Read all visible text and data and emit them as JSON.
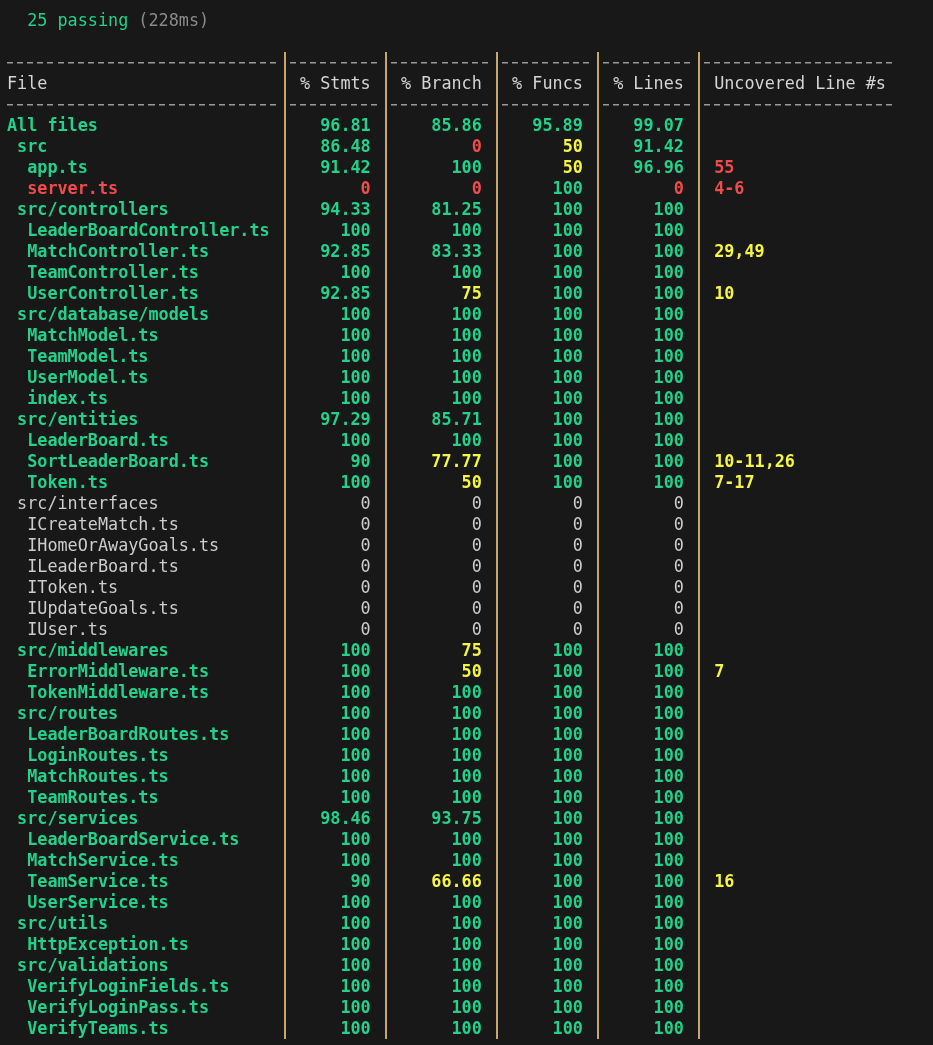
{
  "summary": {
    "count_text": "25 passing",
    "duration": "(228ms)"
  },
  "columns": [
    "File",
    "% Stmts",
    "% Branch",
    "% Funcs",
    "% Lines",
    "Uncovered Line #s"
  ],
  "rows": [
    {
      "name": "All files",
      "bold": true,
      "color": "#23d18b",
      "cells": [
        {
          "text": "96.81",
          "color": "#23d18b"
        },
        {
          "text": "85.86",
          "color": "#23d18b"
        },
        {
          "text": "95.89",
          "color": "#23d18b"
        },
        {
          "text": "99.07",
          "color": "#23d18b"
        }
      ],
      "children": [
        {
          "name": "src",
          "bold": true,
          "color": "#23d18b",
          "cells": [
            {
              "text": "86.48",
              "color": "#23d18b"
            },
            {
              "text": "0",
              "color": "#f14c4c"
            },
            {
              "text": "50",
              "color": "#f5f543"
            },
            {
              "text": "91.42",
              "color": "#23d18b"
            }
          ],
          "children": [
            {
              "name": "app.ts",
              "bold": true,
              "color": "#23d18b",
              "cells": [
                {
                  "text": "91.42",
                  "color": "#23d18b"
                },
                {
                  "text": "100",
                  "color": "#23d18b"
                },
                {
                  "text": "50",
                  "color": "#f5f543"
                },
                {
                  "text": "96.96",
                  "color": "#23d18b"
                }
              ],
              "uncovered": {
                "text": "55",
                "color": "#f14c4c"
              }
            },
            {
              "name": "server.ts",
              "bold": true,
              "color": "#f14c4c",
              "cells": [
                {
                  "text": "0",
                  "color": "#f14c4c"
                },
                {
                  "text": "0",
                  "color": "#f14c4c"
                },
                {
                  "text": "100",
                  "color": "#23d18b"
                },
                {
                  "text": "0",
                  "color": "#f14c4c"
                }
              ],
              "uncovered": {
                "text": "4-6",
                "color": "#f14c4c"
              }
            }
          ]
        },
        {
          "name": "src/controllers",
          "bold": true,
          "color": "#23d18b",
          "cells": [
            {
              "text": "94.33",
              "color": "#23d18b"
            },
            {
              "text": "81.25",
              "color": "#23d18b"
            },
            {
              "text": "100",
              "color": "#23d18b"
            },
            {
              "text": "100",
              "color": "#23d18b"
            }
          ],
          "children": [
            {
              "name": "LeaderBoardController.ts",
              "bold": true,
              "color": "#23d18b",
              "cells": [
                {
                  "text": "100",
                  "color": "#23d18b"
                },
                {
                  "text": "100",
                  "color": "#23d18b"
                },
                {
                  "text": "100",
                  "color": "#23d18b"
                },
                {
                  "text": "100",
                  "color": "#23d18b"
                }
              ]
            },
            {
              "name": "MatchController.ts",
              "bold": true,
              "color": "#23d18b",
              "cells": [
                {
                  "text": "92.85",
                  "color": "#23d18b"
                },
                {
                  "text": "83.33",
                  "color": "#23d18b"
                },
                {
                  "text": "100",
                  "color": "#23d18b"
                },
                {
                  "text": "100",
                  "color": "#23d18b"
                }
              ],
              "uncovered": {
                "text": "29,49",
                "color": "#f5f543"
              }
            },
            {
              "name": "TeamController.ts",
              "bold": true,
              "color": "#23d18b",
              "cells": [
                {
                  "text": "100",
                  "color": "#23d18b"
                },
                {
                  "text": "100",
                  "color": "#23d18b"
                },
                {
                  "text": "100",
                  "color": "#23d18b"
                },
                {
                  "text": "100",
                  "color": "#23d18b"
                }
              ]
            },
            {
              "name": "UserController.ts",
              "bold": true,
              "color": "#23d18b",
              "cells": [
                {
                  "text": "92.85",
                  "color": "#23d18b"
                },
                {
                  "text": "75",
                  "color": "#f5f543"
                },
                {
                  "text": "100",
                  "color": "#23d18b"
                },
                {
                  "text": "100",
                  "color": "#23d18b"
                }
              ],
              "uncovered": {
                "text": "10",
                "color": "#f5f543"
              }
            }
          ]
        },
        {
          "name": "src/database/models",
          "bold": true,
          "color": "#23d18b",
          "cells": [
            {
              "text": "100",
              "color": "#23d18b"
            },
            {
              "text": "100",
              "color": "#23d18b"
            },
            {
              "text": "100",
              "color": "#23d18b"
            },
            {
              "text": "100",
              "color": "#23d18b"
            }
          ],
          "children": [
            {
              "name": "MatchModel.ts",
              "bold": true,
              "color": "#23d18b",
              "cells": [
                {
                  "text": "100",
                  "color": "#23d18b"
                },
                {
                  "text": "100",
                  "color": "#23d18b"
                },
                {
                  "text": "100",
                  "color": "#23d18b"
                },
                {
                  "text": "100",
                  "color": "#23d18b"
                }
              ]
            },
            {
              "name": "TeamModel.ts",
              "bold": true,
              "color": "#23d18b",
              "cells": [
                {
                  "text": "100",
                  "color": "#23d18b"
                },
                {
                  "text": "100",
                  "color": "#23d18b"
                },
                {
                  "text": "100",
                  "color": "#23d18b"
                },
                {
                  "text": "100",
                  "color": "#23d18b"
                }
              ]
            },
            {
              "name": "UserModel.ts",
              "bold": true,
              "color": "#23d18b",
              "cells": [
                {
                  "text": "100",
                  "color": "#23d18b"
                },
                {
                  "text": "100",
                  "color": "#23d18b"
                },
                {
                  "text": "100",
                  "color": "#23d18b"
                },
                {
                  "text": "100",
                  "color": "#23d18b"
                }
              ]
            },
            {
              "name": "index.ts",
              "bold": true,
              "color": "#23d18b",
              "cells": [
                {
                  "text": "100",
                  "color": "#23d18b"
                },
                {
                  "text": "100",
                  "color": "#23d18b"
                },
                {
                  "text": "100",
                  "color": "#23d18b"
                },
                {
                  "text": "100",
                  "color": "#23d18b"
                }
              ]
            }
          ]
        },
        {
          "name": "src/entities",
          "bold": true,
          "color": "#23d18b",
          "cells": [
            {
              "text": "97.29",
              "color": "#23d18b"
            },
            {
              "text": "85.71",
              "color": "#23d18b"
            },
            {
              "text": "100",
              "color": "#23d18b"
            },
            {
              "text": "100",
              "color": "#23d18b"
            }
          ],
          "children": [
            {
              "name": "LeaderBoard.ts",
              "bold": true,
              "color": "#23d18b",
              "cells": [
                {
                  "text": "100",
                  "color": "#23d18b"
                },
                {
                  "text": "100",
                  "color": "#23d18b"
                },
                {
                  "text": "100",
                  "color": "#23d18b"
                },
                {
                  "text": "100",
                  "color": "#23d18b"
                }
              ]
            },
            {
              "name": "SortLeaderBoard.ts",
              "bold": true,
              "color": "#23d18b",
              "cells": [
                {
                  "text": "90",
                  "color": "#23d18b"
                },
                {
                  "text": "77.77",
                  "color": "#f5f543"
                },
                {
                  "text": "100",
                  "color": "#23d18b"
                },
                {
                  "text": "100",
                  "color": "#23d18b"
                }
              ],
              "uncovered": {
                "text": "10-11,26",
                "color": "#f5f543"
              }
            },
            {
              "name": "Token.ts",
              "bold": true,
              "color": "#23d18b",
              "cells": [
                {
                  "text": "100",
                  "color": "#23d18b"
                },
                {
                  "text": "50",
                  "color": "#f5f543"
                },
                {
                  "text": "100",
                  "color": "#23d18b"
                },
                {
                  "text": "100",
                  "color": "#23d18b"
                }
              ],
              "uncovered": {
                "text": "7-17",
                "color": "#f5f543"
              }
            }
          ]
        },
        {
          "name": "src/interfaces",
          "bold": false,
          "color": "#cccccc",
          "cells": [
            {
              "text": "0",
              "color": "#cccccc"
            },
            {
              "text": "0",
              "color": "#cccccc"
            },
            {
              "text": "0",
              "color": "#cccccc"
            },
            {
              "text": "0",
              "color": "#cccccc"
            }
          ],
          "children": [
            {
              "name": "ICreateMatch.ts",
              "bold": false,
              "color": "#cccccc",
              "cells": [
                {
                  "text": "0",
                  "color": "#cccccc"
                },
                {
                  "text": "0",
                  "color": "#cccccc"
                },
                {
                  "text": "0",
                  "color": "#cccccc"
                },
                {
                  "text": "0",
                  "color": "#cccccc"
                }
              ]
            },
            {
              "name": "IHomeOrAwayGoals.ts",
              "bold": false,
              "color": "#cccccc",
              "cells": [
                {
                  "text": "0",
                  "color": "#cccccc"
                },
                {
                  "text": "0",
                  "color": "#cccccc"
                },
                {
                  "text": "0",
                  "color": "#cccccc"
                },
                {
                  "text": "0",
                  "color": "#cccccc"
                }
              ]
            },
            {
              "name": "ILeaderBoard.ts",
              "bold": false,
              "color": "#cccccc",
              "cells": [
                {
                  "text": "0",
                  "color": "#cccccc"
                },
                {
                  "text": "0",
                  "color": "#cccccc"
                },
                {
                  "text": "0",
                  "color": "#cccccc"
                },
                {
                  "text": "0",
                  "color": "#cccccc"
                }
              ]
            },
            {
              "name": "IToken.ts",
              "bold": false,
              "color": "#cccccc",
              "cells": [
                {
                  "text": "0",
                  "color": "#cccccc"
                },
                {
                  "text": "0",
                  "color": "#cccccc"
                },
                {
                  "text": "0",
                  "color": "#cccccc"
                },
                {
                  "text": "0",
                  "color": "#cccccc"
                }
              ]
            },
            {
              "name": "IUpdateGoals.ts",
              "bold": false,
              "color": "#cccccc",
              "cells": [
                {
                  "text": "0",
                  "color": "#cccccc"
                },
                {
                  "text": "0",
                  "color": "#cccccc"
                },
                {
                  "text": "0",
                  "color": "#cccccc"
                },
                {
                  "text": "0",
                  "color": "#cccccc"
                }
              ]
            },
            {
              "name": "IUser.ts",
              "bold": false,
              "color": "#cccccc",
              "cells": [
                {
                  "text": "0",
                  "color": "#cccccc"
                },
                {
                  "text": "0",
                  "color": "#cccccc"
                },
                {
                  "text": "0",
                  "color": "#cccccc"
                },
                {
                  "text": "0",
                  "color": "#cccccc"
                }
              ]
            }
          ]
        },
        {
          "name": "src/middlewares",
          "bold": true,
          "color": "#23d18b",
          "cells": [
            {
              "text": "100",
              "color": "#23d18b"
            },
            {
              "text": "75",
              "color": "#f5f543"
            },
            {
              "text": "100",
              "color": "#23d18b"
            },
            {
              "text": "100",
              "color": "#23d18b"
            }
          ],
          "children": [
            {
              "name": "ErrorMiddleware.ts",
              "bold": true,
              "color": "#23d18b",
              "cells": [
                {
                  "text": "100",
                  "color": "#23d18b"
                },
                {
                  "text": "50",
                  "color": "#f5f543"
                },
                {
                  "text": "100",
                  "color": "#23d18b"
                },
                {
                  "text": "100",
                  "color": "#23d18b"
                }
              ],
              "uncovered": {
                "text": "7",
                "color": "#f5f543"
              }
            },
            {
              "name": "TokenMiddleware.ts",
              "bold": true,
              "color": "#23d18b",
              "cells": [
                {
                  "text": "100",
                  "color": "#23d18b"
                },
                {
                  "text": "100",
                  "color": "#23d18b"
                },
                {
                  "text": "100",
                  "color": "#23d18b"
                },
                {
                  "text": "100",
                  "color": "#23d18b"
                }
              ]
            }
          ]
        },
        {
          "name": "src/routes",
          "bold": true,
          "color": "#23d18b",
          "cells": [
            {
              "text": "100",
              "color": "#23d18b"
            },
            {
              "text": "100",
              "color": "#23d18b"
            },
            {
              "text": "100",
              "color": "#23d18b"
            },
            {
              "text": "100",
              "color": "#23d18b"
            }
          ],
          "children": [
            {
              "name": "LeaderBoardRoutes.ts",
              "bold": true,
              "color": "#23d18b",
              "cells": [
                {
                  "text": "100",
                  "color": "#23d18b"
                },
                {
                  "text": "100",
                  "color": "#23d18b"
                },
                {
                  "text": "100",
                  "color": "#23d18b"
                },
                {
                  "text": "100",
                  "color": "#23d18b"
                }
              ]
            },
            {
              "name": "LoginRoutes.ts",
              "bold": true,
              "color": "#23d18b",
              "cells": [
                {
                  "text": "100",
                  "color": "#23d18b"
                },
                {
                  "text": "100",
                  "color": "#23d18b"
                },
                {
                  "text": "100",
                  "color": "#23d18b"
                },
                {
                  "text": "100",
                  "color": "#23d18b"
                }
              ]
            },
            {
              "name": "MatchRoutes.ts",
              "bold": true,
              "color": "#23d18b",
              "cells": [
                {
                  "text": "100",
                  "color": "#23d18b"
                },
                {
                  "text": "100",
                  "color": "#23d18b"
                },
                {
                  "text": "100",
                  "color": "#23d18b"
                },
                {
                  "text": "100",
                  "color": "#23d18b"
                }
              ]
            },
            {
              "name": "TeamRoutes.ts",
              "bold": true,
              "color": "#23d18b",
              "cells": [
                {
                  "text": "100",
                  "color": "#23d18b"
                },
                {
                  "text": "100",
                  "color": "#23d18b"
                },
                {
                  "text": "100",
                  "color": "#23d18b"
                },
                {
                  "text": "100",
                  "color": "#23d18b"
                }
              ]
            }
          ]
        },
        {
          "name": "src/services",
          "bold": true,
          "color": "#23d18b",
          "cells": [
            {
              "text": "98.46",
              "color": "#23d18b"
            },
            {
              "text": "93.75",
              "color": "#23d18b"
            },
            {
              "text": "100",
              "color": "#23d18b"
            },
            {
              "text": "100",
              "color": "#23d18b"
            }
          ],
          "children": [
            {
              "name": "LeaderBoardService.ts",
              "bold": true,
              "color": "#23d18b",
              "cells": [
                {
                  "text": "100",
                  "color": "#23d18b"
                },
                {
                  "text": "100",
                  "color": "#23d18b"
                },
                {
                  "text": "100",
                  "color": "#23d18b"
                },
                {
                  "text": "100",
                  "color": "#23d18b"
                }
              ]
            },
            {
              "name": "MatchService.ts",
              "bold": true,
              "color": "#23d18b",
              "cells": [
                {
                  "text": "100",
                  "color": "#23d18b"
                },
                {
                  "text": "100",
                  "color": "#23d18b"
                },
                {
                  "text": "100",
                  "color": "#23d18b"
                },
                {
                  "text": "100",
                  "color": "#23d18b"
                }
              ]
            },
            {
              "name": "TeamService.ts",
              "bold": true,
              "color": "#23d18b",
              "cells": [
                {
                  "text": "90",
                  "color": "#23d18b"
                },
                {
                  "text": "66.66",
                  "color": "#f5f543"
                },
                {
                  "text": "100",
                  "color": "#23d18b"
                },
                {
                  "text": "100",
                  "color": "#23d18b"
                }
              ],
              "uncovered": {
                "text": "16",
                "color": "#f5f543"
              }
            },
            {
              "name": "UserService.ts",
              "bold": true,
              "color": "#23d18b",
              "cells": [
                {
                  "text": "100",
                  "color": "#23d18b"
                },
                {
                  "text": "100",
                  "color": "#23d18b"
                },
                {
                  "text": "100",
                  "color": "#23d18b"
                },
                {
                  "text": "100",
                  "color": "#23d18b"
                }
              ]
            }
          ]
        },
        {
          "name": "src/utils",
          "bold": true,
          "color": "#23d18b",
          "cells": [
            {
              "text": "100",
              "color": "#23d18b"
            },
            {
              "text": "100",
              "color": "#23d18b"
            },
            {
              "text": "100",
              "color": "#23d18b"
            },
            {
              "text": "100",
              "color": "#23d18b"
            }
          ],
          "children": [
            {
              "name": "HttpException.ts",
              "bold": true,
              "color": "#23d18b",
              "cells": [
                {
                  "text": "100",
                  "color": "#23d18b"
                },
                {
                  "text": "100",
                  "color": "#23d18b"
                },
                {
                  "text": "100",
                  "color": "#23d18b"
                },
                {
                  "text": "100",
                  "color": "#23d18b"
                }
              ]
            }
          ]
        },
        {
          "name": "src/validations",
          "bold": true,
          "color": "#23d18b",
          "cells": [
            {
              "text": "100",
              "color": "#23d18b"
            },
            {
              "text": "100",
              "color": "#23d18b"
            },
            {
              "text": "100",
              "color": "#23d18b"
            },
            {
              "text": "100",
              "color": "#23d18b"
            }
          ],
          "children": [
            {
              "name": "VerifyLoginFields.ts",
              "bold": true,
              "color": "#23d18b",
              "cells": [
                {
                  "text": "100",
                  "color": "#23d18b"
                },
                {
                  "text": "100",
                  "color": "#23d18b"
                },
                {
                  "text": "100",
                  "color": "#23d18b"
                },
                {
                  "text": "100",
                  "color": "#23d18b"
                }
              ]
            },
            {
              "name": "VerifyLoginPass.ts",
              "bold": true,
              "color": "#23d18b",
              "cells": [
                {
                  "text": "100",
                  "color": "#23d18b"
                },
                {
                  "text": "100",
                  "color": "#23d18b"
                },
                {
                  "text": "100",
                  "color": "#23d18b"
                },
                {
                  "text": "100",
                  "color": "#23d18b"
                }
              ]
            },
            {
              "name": "VerifyTeams.ts",
              "bold": true,
              "color": "#23d18b",
              "cells": [
                {
                  "text": "100",
                  "color": "#23d18b"
                },
                {
                  "text": "100",
                  "color": "#23d18b"
                },
                {
                  "text": "100",
                  "color": "#23d18b"
                },
                {
                  "text": "100",
                  "color": "#23d18b"
                }
              ]
            }
          ]
        }
      ]
    }
  ]
}
